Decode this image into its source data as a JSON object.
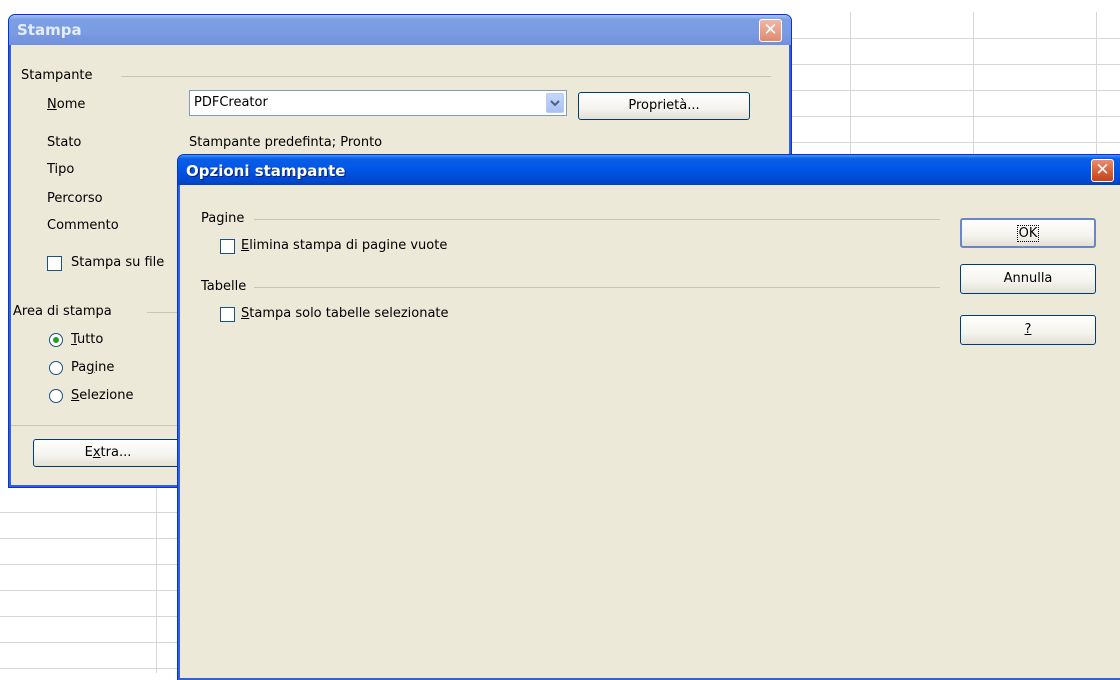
{
  "print_dialog": {
    "title": "Stampa",
    "close_symbol": "✕",
    "printer_group": "Stampante",
    "name_label": "Nome",
    "name_value": "PDFCreator",
    "properties_label": "Proprietà...",
    "status_label": "Stato",
    "status_value": "Stampante predefinta; Pronto",
    "type_label": "Tipo",
    "path_label": "Percorso",
    "comment_label": "Commento",
    "print_to_file_label": "Stampa su file",
    "print_area_group": "Area di stampa",
    "radio_all": "Tutto",
    "radio_pages": "Pagine",
    "radio_selection": "Selezione",
    "selected_print_area": "Tutto",
    "extra_label": "Extra..."
  },
  "options_dialog": {
    "title": "Opzioni stampante",
    "close_symbol": "✕",
    "pages_group": "Pagine",
    "skip_blank_label": "Elimina stampa di pagine vuote",
    "skip_blank_checked": false,
    "tables_group": "Tabelle",
    "selected_sheets_label": "Stampa solo tabelle selezionate",
    "selected_sheets_checked": false,
    "ok_label": "OK",
    "cancel_label": "Annulla",
    "help_label": "?"
  },
  "colors": {
    "titlebar_active": "#0055e5",
    "dialog_face": "#ece9d8",
    "close_button": "#d95a32"
  }
}
